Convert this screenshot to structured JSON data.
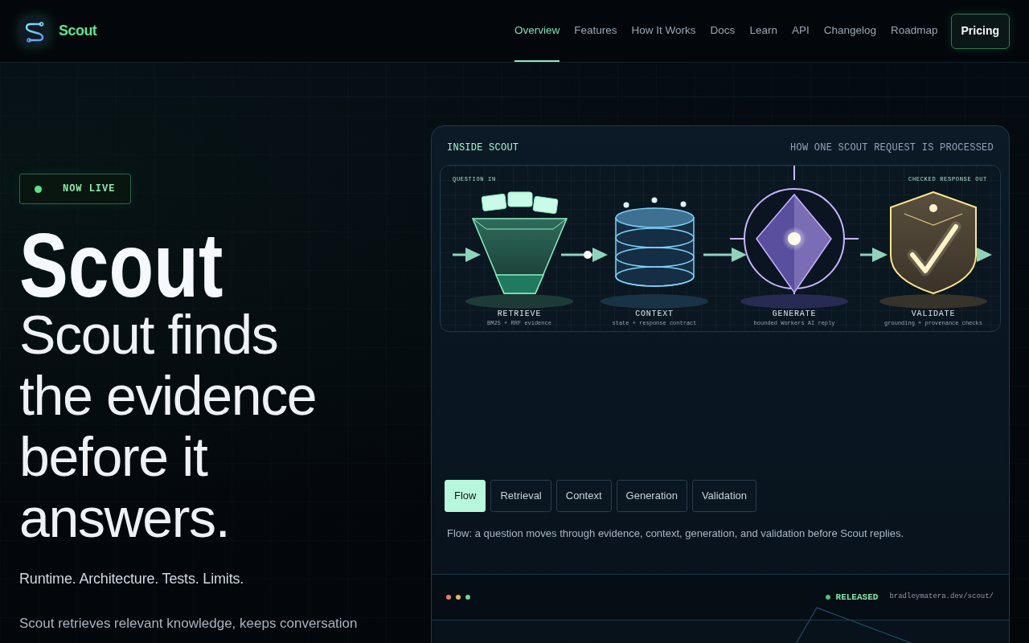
{
  "header": {
    "brand": "Scout",
    "nav": [
      {
        "label": "Overview",
        "selected": true
      },
      {
        "label": "Features",
        "selected": false
      },
      {
        "label": "How It Works",
        "selected": false
      },
      {
        "label": "Docs",
        "selected": false
      },
      {
        "label": "Learn",
        "selected": false
      },
      {
        "label": "API",
        "selected": false
      },
      {
        "label": "Changelog",
        "selected": false
      },
      {
        "label": "Roadmap",
        "selected": false
      }
    ],
    "cta": "Pricing"
  },
  "hero": {
    "badge": "NOW LIVE",
    "title": "Scout",
    "headline": "Scout finds the evidence before it answers.",
    "tagline": "Runtime. Architecture. Tests. Limits.",
    "description": "Scout retrieves relevant knowledge, keeps conversation"
  },
  "panel": {
    "eyebrow": "INSIDE SCOUT",
    "caption": "HOW ONE SCOUT REQUEST IS PROCESSED",
    "diagram": {
      "input_label": "QUESTION IN",
      "output_label": "CHECKED RESPONSE OUT",
      "stages": [
        {
          "kind": "retrieve",
          "title": "RETRIEVE",
          "detail": "BM25 + RRF evidence"
        },
        {
          "kind": "context",
          "title": "CONTEXT",
          "detail": "state + response contract"
        },
        {
          "kind": "generate",
          "title": "GENERATE",
          "detail": "bounded Workers AI reply"
        },
        {
          "kind": "validate",
          "title": "VALIDATE",
          "detail": "grounding + provenance checks"
        }
      ]
    },
    "tabs": [
      {
        "label": "Flow",
        "selected": true
      },
      {
        "label": "Retrieval",
        "selected": false
      },
      {
        "label": "Context",
        "selected": false
      },
      {
        "label": "Generation",
        "selected": false
      },
      {
        "label": "Validation",
        "selected": false
      }
    ],
    "tab_description": "Flow: a question moves through evidence, context, generation, and validation before Scout replies.",
    "release": {
      "status": "RELEASED",
      "url": "bradleymatera.dev/scout/"
    }
  }
}
